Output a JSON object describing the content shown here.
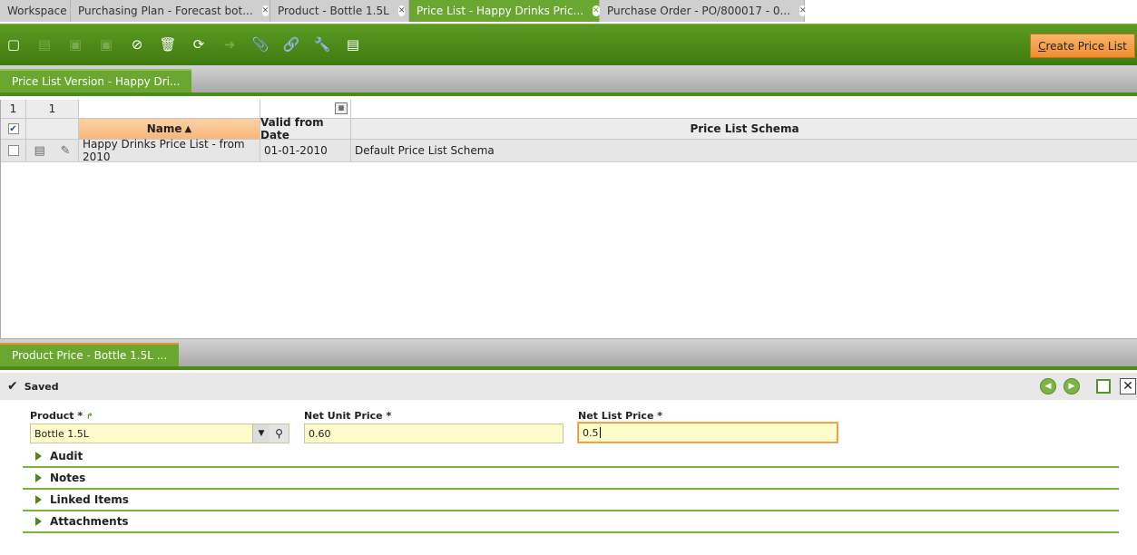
{
  "tabs": [
    {
      "label": "Workspace",
      "closable": false
    },
    {
      "label": "Purchasing Plan - Forecast bot...",
      "closable": true
    },
    {
      "label": "Product - Bottle 1.5L",
      "closable": true
    },
    {
      "label": "Price List - Happy Drinks Pric...",
      "closable": true,
      "active": true
    },
    {
      "label": "Purchase Order - PO/800017 - 0...",
      "closable": true
    }
  ],
  "toolbar": {
    "icons": [
      "new-document-icon",
      "grid-view-icon",
      "save-icon",
      "save-close-icon",
      "undo-icon",
      "delete-icon",
      "refresh-icon",
      "export-icon",
      "attachment-icon",
      "link-icon",
      "tools-icon",
      "toggle-view-icon"
    ],
    "create_button": {
      "access_key": "C",
      "rest": "reate Price List"
    }
  },
  "section1": {
    "title": "Price List Version - Happy Dri..."
  },
  "grid": {
    "filter_counts": [
      "1",
      "1"
    ],
    "headers": {
      "name": "Name",
      "valid_from": "Valid from Date",
      "schema": "Price List Schema"
    },
    "rows": [
      {
        "name": "Happy Drinks Price List - from 2010",
        "valid_from": "01-01-2010",
        "schema": "Default Price List Schema"
      }
    ]
  },
  "section2": {
    "title": "Product Price - Bottle 1.5L ..."
  },
  "form": {
    "status": "Saved",
    "product_label": "Product *",
    "product_value": "Bottle 1.5L",
    "net_unit_label": "Net Unit Price *",
    "net_unit_value": "0.60",
    "net_list_label": "Net List Price *",
    "net_list_value": "0.5"
  },
  "sections": [
    "Audit",
    "Notes",
    "Linked Items",
    "Attachments"
  ],
  "colors": {
    "accent": "#4d8a1a",
    "tab_active": "#6aa730",
    "create_button": "#f08e2a",
    "field_bg": "#fffccc"
  }
}
